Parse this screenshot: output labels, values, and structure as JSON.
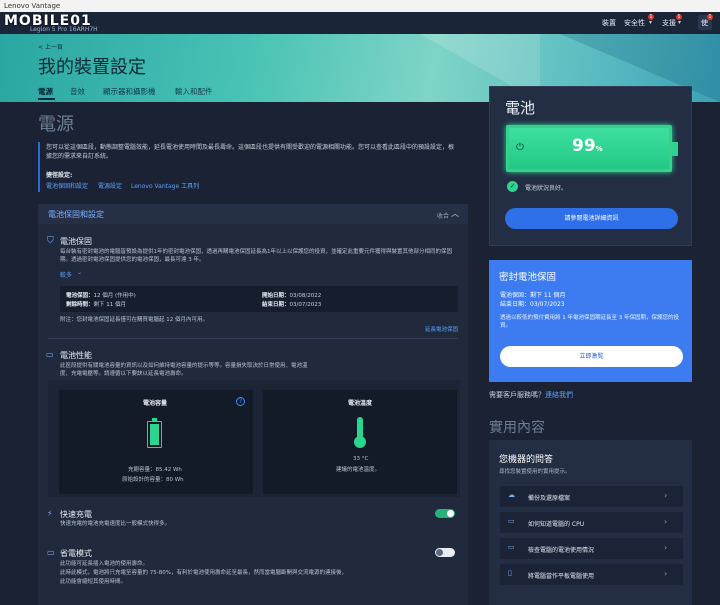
{
  "window": {
    "title": "Lenovo Vantage"
  },
  "logo": {
    "text": "MOBILE01",
    "sub": "Legion 5 Pro 16ARH7H"
  },
  "topnav": {
    "devices": "裝置",
    "security": "安全性",
    "support": "支援",
    "user": "使",
    "security_badge": "1",
    "support_badge": "1",
    "user_badge": "1"
  },
  "hero": {
    "back": "< 上一頁",
    "title": "我的裝置設定",
    "tabs": [
      "電源",
      "音效",
      "顯示器和攝影機",
      "輸入和配件"
    ]
  },
  "power": {
    "heading": "電源",
    "intro": "您可以從這個區段，動態調整電腦效能，延長電池使用時間及最長壽命。這個區段也提供有關受歡迎的電源相關功能。您可以查看此區段中的預設設定，根據您的需求來自訂系統。",
    "shortcuts_heading": "捷徑設定:",
    "shortcuts": [
      "電池保固和設定",
      "電源設定",
      "Lenovo Vantage 工具列"
    ]
  },
  "battery_protection": {
    "title": "電池保固和設定",
    "collapse": "收合",
    "warranty": {
      "title": "電池保固",
      "desc": "每台裝有密封電池的電腦皆預設為提供1年的密封電池保固，透過再購電池保固延長為1年以上以保護您的投資，並確定此重要元件獲得與裝置其他部分相同的保固期。透過密封電池保固提供您的電池保固，最長可達 3 年。",
      "more": "較多",
      "rows": [
        {
          "k": "電池保固：",
          "v": "12 個月 (作用中)"
        },
        {
          "k": "剩餘時間：",
          "v": "剩下 11 個月"
        },
        {
          "k": "開始日期：",
          "v": "03/08/2022"
        },
        {
          "k": "結束日期：",
          "v": "03/07/2023"
        }
      ],
      "note": "附注：您封電池保固延長僅可在購買電腦起 12 個月內可用。",
      "extend": "延長電池保固"
    },
    "performance": {
      "title": "電池性能",
      "desc": "此區段提供有關電池容量的資訊以及如何維持電池容量的提示等等。容量損失取決於日常使用、電池溫度、充電電壓等。請遵循以下要訣以延長電池壽命。",
      "capacity_title": "電池容量",
      "capacity_full": "充飽容量：85.42 Wh",
      "capacity_design": "原始設計的容量：80 Wh",
      "temp_title": "電池溫度",
      "temp_value": "33 °C",
      "temp_note": "建議的電池溫度。"
    },
    "rapid_charge": {
      "title": "快速充電",
      "desc": "快速充電的電池充電速度比一般模式快得多。",
      "on": true
    },
    "conservation": {
      "title": "省電模式",
      "desc1": "此功能可延長插入電池的使用壽命。",
      "desc2": "此時此模式，電池將只充電至容量的 75-80%，有利於電池使用壽命延至最長，然而當電腦斷開與交流電源的連接後，",
      "desc3": "此功能會縮短其使用時間。",
      "on": false
    }
  },
  "battery_card": {
    "title": "電池",
    "percent": "99",
    "unit": "%",
    "status": "電池狀況良好。",
    "button": "請參閱電池詳細資訊",
    "level": 0.99
  },
  "sealed_warranty": {
    "title": "密封電池保固",
    "line1": "電池保固：剩下 11 個月",
    "line2": "結束日期：03/07/2023",
    "desc": "透過以較低的預付費用將 1 年電池保固期延長至 3 年保固期，保護您的投資。",
    "button": "立即激覧"
  },
  "help": {
    "prefix": "需要客戶服務嗎？",
    "link": "連絡我們"
  },
  "useful": {
    "heading": "實用內容",
    "qa_title": "您機器的問答",
    "qa_sub": "尋找您裝置使用的實用提示。",
    "items": [
      "備份及還原檔案",
      "如何知道電腦的 CPU",
      "檢查電腦的電池使用情況",
      "將電腦當作平板電腦使用"
    ]
  },
  "colors": {
    "accent": "#2f6fe8",
    "battery_green": "#2ad58f",
    "hero_teal": "#49c3b5"
  }
}
